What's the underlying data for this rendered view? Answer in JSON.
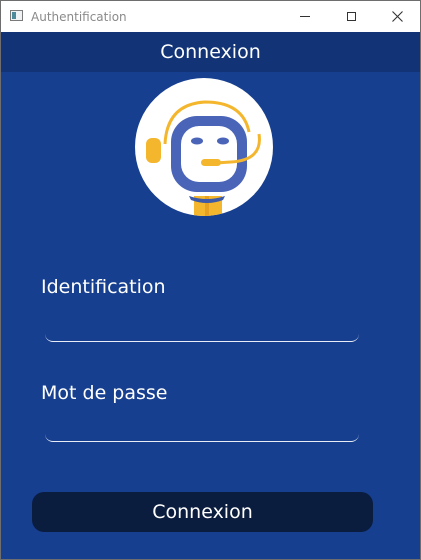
{
  "window": {
    "title": "Authentification",
    "controls": {
      "minimize": "minimize-icon",
      "maximize": "maximize-icon",
      "close": "close-icon"
    }
  },
  "header": {
    "title": "Connexion"
  },
  "avatar": {
    "icon": "support-robot-headset-icon"
  },
  "form": {
    "username_label": "Identification",
    "username_value": "",
    "password_label": "Mot de passe",
    "password_value": ""
  },
  "submit": {
    "label": "Connexion"
  },
  "colors": {
    "background": "#173f8f",
    "header": "#123476",
    "button": "#0b1d3e",
    "accent": "#f4b62d"
  }
}
